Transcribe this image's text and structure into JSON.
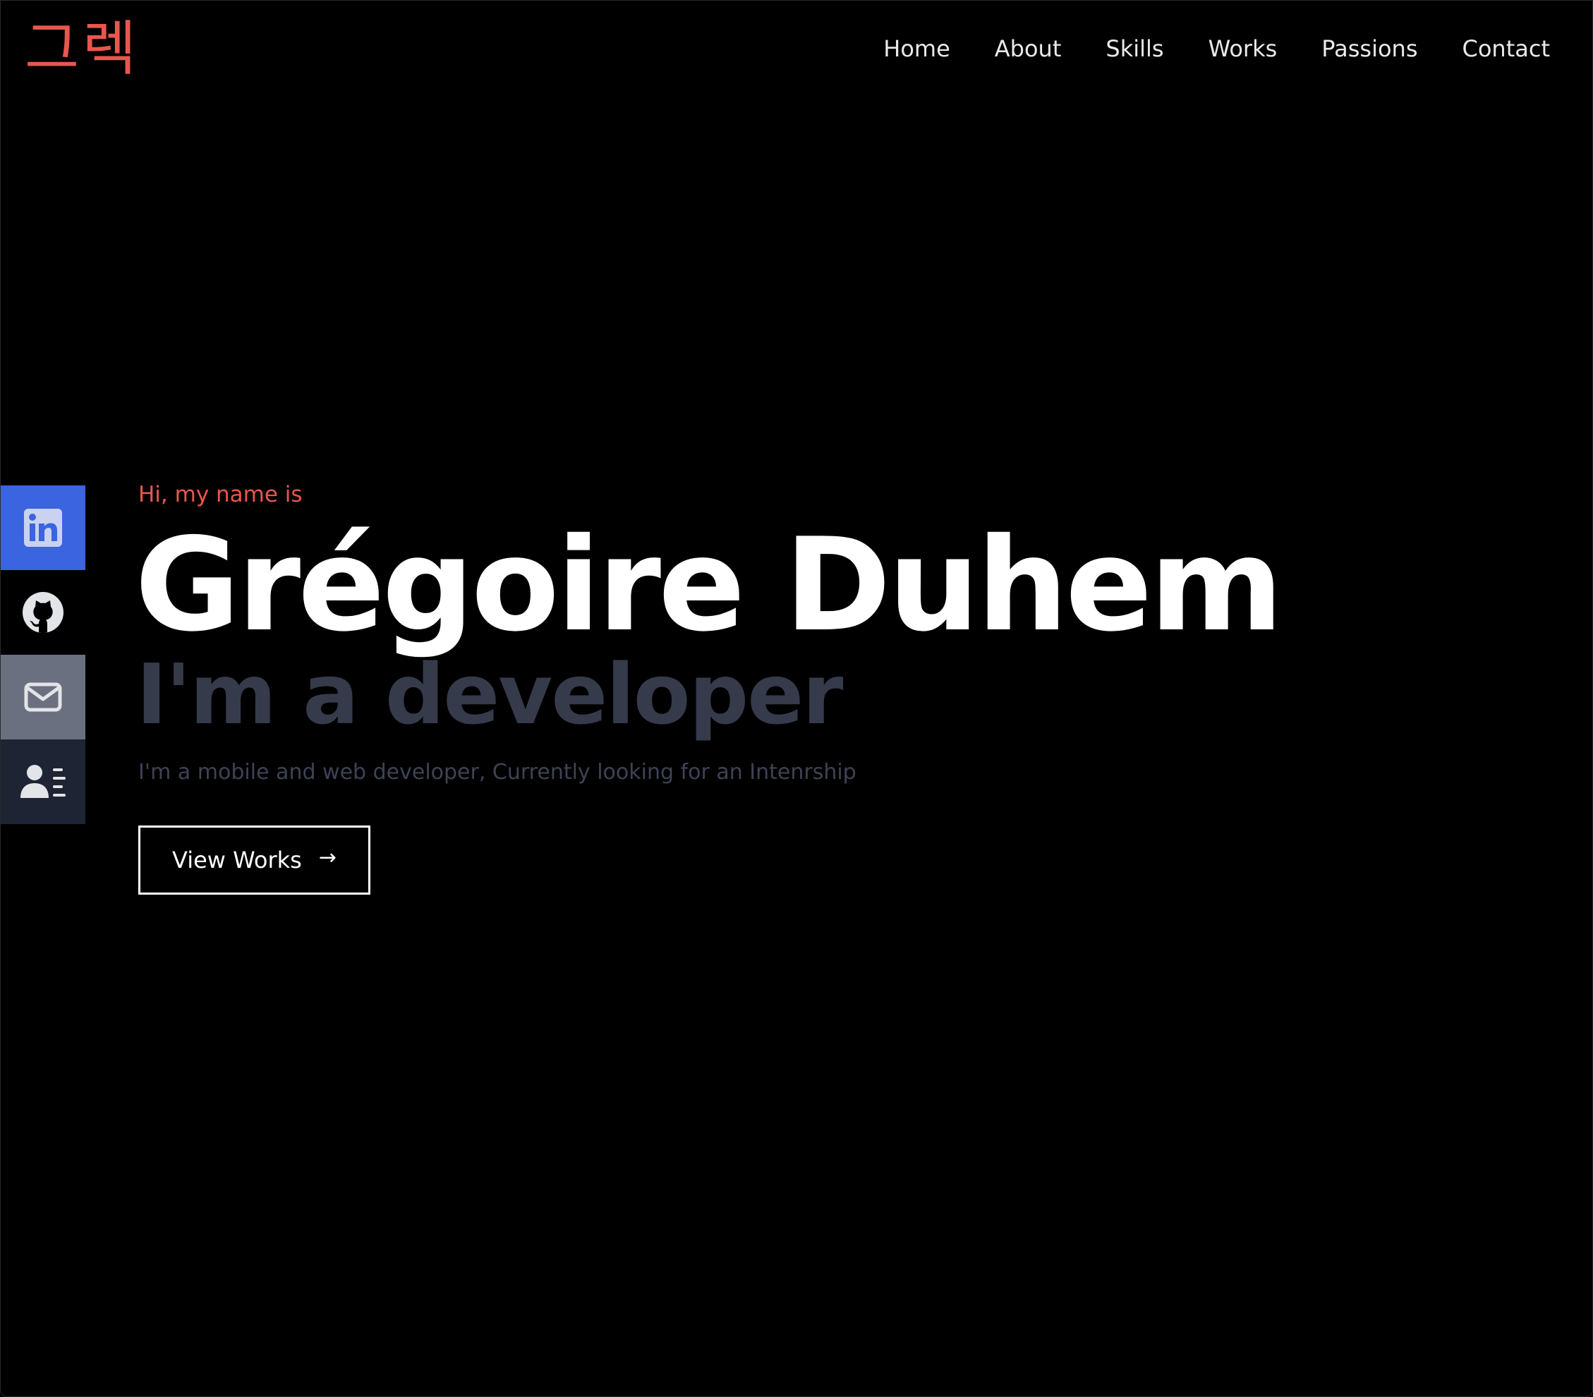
{
  "header": {
    "logo_text": "그렉",
    "nav": [
      {
        "label": "Home"
      },
      {
        "label": "About"
      },
      {
        "label": "Skills"
      },
      {
        "label": "Works"
      },
      {
        "label": "Passions"
      },
      {
        "label": "Contact"
      }
    ]
  },
  "social": [
    {
      "icon": "linkedin-icon",
      "color": "#3b64e0"
    },
    {
      "icon": "github-icon",
      "color": "#000000"
    },
    {
      "icon": "mail-icon",
      "color": "#6b7080"
    },
    {
      "icon": "resume-icon",
      "color": "#1f2434"
    }
  ],
  "hero": {
    "greeting": "Hi, my name is",
    "name": "Grégoire Duhem",
    "role": "I'm a developer",
    "description": "I'm a mobile and web developer, Currently looking for an Intenrship",
    "cta_label": "View Works",
    "cta_arrow": "→"
  },
  "colors": {
    "accent": "#e8574e",
    "background": "#000000",
    "role_text": "#363b4b",
    "description_text": "#3e4354"
  }
}
